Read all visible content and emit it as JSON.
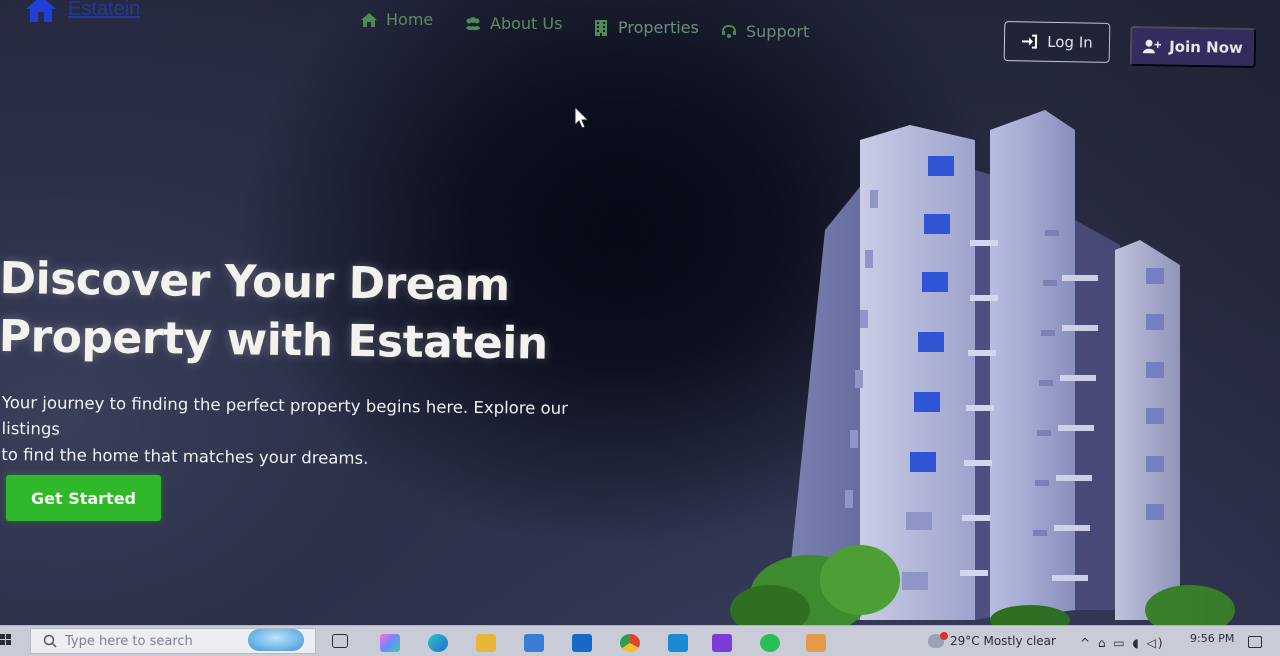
{
  "brand": {
    "name": "Estatein"
  },
  "nav": {
    "items": [
      {
        "label": "Home",
        "icon": "home-icon"
      },
      {
        "label": "About Us",
        "icon": "users-icon"
      },
      {
        "label": "Properties",
        "icon": "building-icon"
      },
      {
        "label": "Support",
        "icon": "headset-icon"
      }
    ],
    "login_label": "Log In",
    "join_label": "Join Now"
  },
  "hero": {
    "title_line1": "Discover Your Dream",
    "title_line2": "Property with Estatein",
    "subtitle_line1": "Your journey to finding the perfect property begins here. Explore our listings",
    "subtitle_line2": "to find the home that matches your dreams.",
    "cta_label": "Get Started"
  },
  "taskbar": {
    "search_placeholder": "Type here to search",
    "weather": "29°C  Mostly clear",
    "time": "9:56 PM"
  },
  "colors": {
    "accent_green": "#2fb82a",
    "join_purple": "#3a2f66",
    "nav_green": "#5f8a62",
    "brand_blue": "#1f3fb5"
  }
}
